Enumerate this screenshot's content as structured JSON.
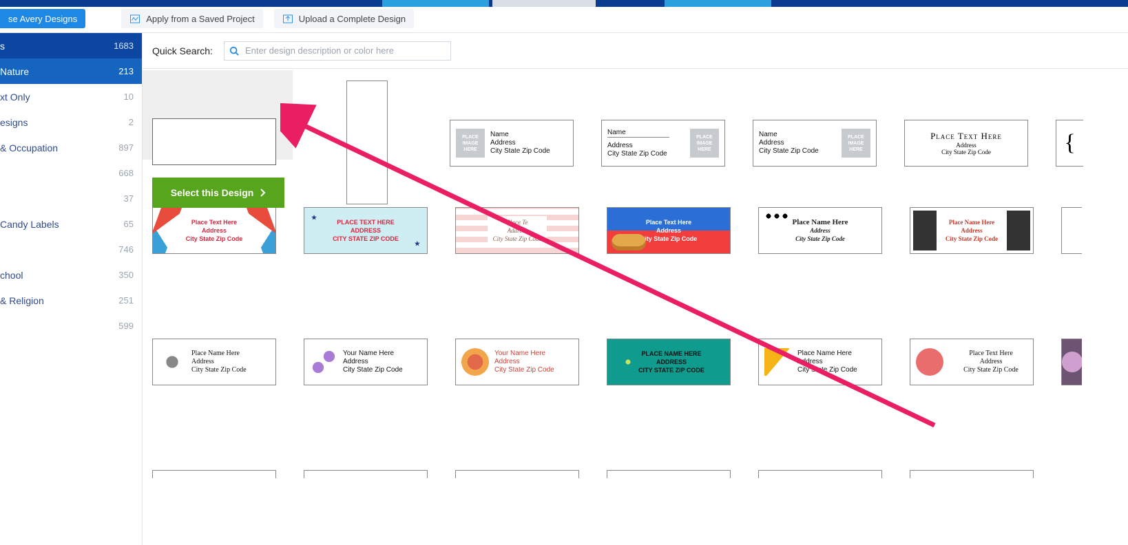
{
  "actions": {
    "browse": "se Avery Designs",
    "apply": "Apply from a Saved Project",
    "upload": "Upload a Complete Design"
  },
  "sidebar": {
    "items": [
      {
        "label": "s",
        "count": "1683",
        "kind": "header"
      },
      {
        "label": "Nature",
        "count": "213",
        "kind": "active"
      },
      {
        "label": "xt Only",
        "count": "10"
      },
      {
        "label": "esigns",
        "count": "2"
      },
      {
        "label": "& Occupation",
        "count": "897"
      },
      {
        "label": "",
        "count": "668"
      },
      {
        "label": "",
        "count": "37"
      },
      {
        "label": "Candy Labels",
        "count": "65"
      },
      {
        "label": "",
        "count": "746"
      },
      {
        "label": "chool",
        "count": "350"
      },
      {
        "label": "& Religion",
        "count": "251"
      },
      {
        "label": "",
        "count": "599"
      }
    ]
  },
  "search": {
    "label": "Quick Search:",
    "placeholder": "Enter design description or color here"
  },
  "select_btn": "Select this Design",
  "ph_image": "PLACE IMAGE HERE",
  "generic": {
    "name": "Name",
    "addr": "Address",
    "csz": "City State Zip Code"
  },
  "frame": {
    "t1": "Place Text Here",
    "t2": "Address",
    "t3": "City State Zip Code"
  },
  "bracket": "{",
  "row2": {
    "c1": {
      "t1": "Place Text Here",
      "t2": "Address",
      "t3": "City State Zip Code"
    },
    "c2": {
      "t1": "PLACE TEXT HERE",
      "t2": "ADDRESS",
      "t3": "CITY STATE ZIP CODE"
    },
    "c3": {
      "t1": "Place Te",
      "t2": "Address",
      "t3": "City State Zip Code"
    },
    "c4": {
      "t1": "Place Text Here",
      "t2": "Address",
      "t3": "City State Zip Code"
    },
    "c5": {
      "t1": "Place Name Here",
      "t2": "Address",
      "t3": "City State Zip Code"
    },
    "c6": {
      "t1": "Place Name Here",
      "t2": "Address",
      "t3": "City State Zip Code"
    }
  },
  "row3": {
    "c1": {
      "t1": "Place Name Here",
      "t2": "Address",
      "t3": "City State Zip Code"
    },
    "c2": {
      "t1": "Your Name Here",
      "t2": "Address",
      "t3": "City State Zip Code"
    },
    "c3": {
      "t1": "Your Name Here",
      "t2": "Address",
      "t3": "City State Zip Code"
    },
    "c4": {
      "t1": "PLACE NAME HERE",
      "t2": "ADDRESS",
      "t3": "CITY STATE ZIP CODE"
    },
    "c5": {
      "t1": "Place Name Here",
      "t2": "Address",
      "t3": "City State Zip Code"
    },
    "c6": {
      "t1": "Place Text Here",
      "t2": "Address",
      "t3": "City State Zip Code"
    }
  }
}
